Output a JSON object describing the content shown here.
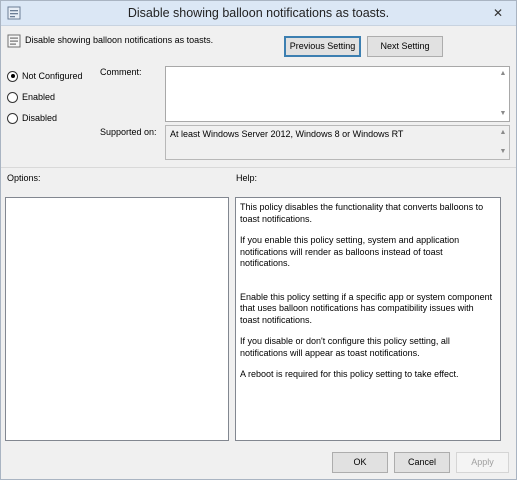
{
  "window": {
    "title": "Disable showing balloon notifications as toasts.",
    "close_glyph": "✕"
  },
  "policy": {
    "name": "Disable showing balloon notifications as toasts."
  },
  "nav": {
    "previous_label": "Previous Setting",
    "next_label": "Next Setting"
  },
  "state": {
    "options": [
      {
        "label": "Not Configured",
        "checked": true
      },
      {
        "label": "Enabled",
        "checked": false
      },
      {
        "label": "Disabled",
        "checked": false
      }
    ]
  },
  "comment": {
    "label": "Comment:",
    "value": ""
  },
  "supported": {
    "label": "Supported on:",
    "value": "At least Windows Server 2012, Windows 8 or Windows RT"
  },
  "options_panel": {
    "label": "Options:"
  },
  "help_panel": {
    "label": "Help:",
    "paragraphs": [
      "This policy disables the functionality that converts balloons to toast notifications.",
      "If you enable this policy setting, system and application notifications will render as balloons instead of toast notifications.",
      "Enable this policy setting if a specific app or system component that uses balloon notifications has compatibility issues with toast notifications.",
      "If you disable or don't configure this policy setting, all notifications will appear as toast notifications.",
      "A reboot is required for this policy setting to take effect."
    ]
  },
  "footer": {
    "ok_label": "OK",
    "cancel_label": "Cancel",
    "apply_label": "Apply"
  },
  "icons": {
    "app": "policy-app-icon",
    "policy": "policy-setting-icon",
    "close": "close-icon",
    "scroll_up": "scroll-up-arrow-icon",
    "scroll_down": "scroll-down-arrow-icon"
  },
  "colors": {
    "titlebar": "#dbe7f5",
    "window_bg": "#f0f0f0",
    "default_button_border": "#3c7fb1"
  }
}
